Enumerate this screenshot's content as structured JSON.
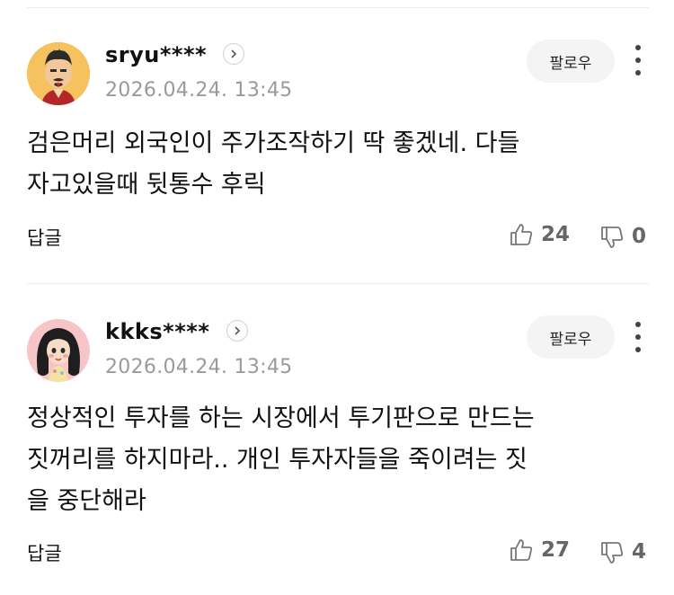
{
  "comments": [
    {
      "username": "sryu****",
      "timestamp": "2026.04.24. 13:45",
      "follow_label": "팔로우",
      "text": "검은머리 외국인이 주가조작하기 딱 좋겠네. 다들\n자고있을때 뒷통수 후릭",
      "reply_label": "답글",
      "likes": "24",
      "dislikes": "0"
    },
    {
      "username": "kkks****",
      "timestamp": "2026.04.24. 13:45",
      "follow_label": "팔로우",
      "text": "정상적인 투자를 하는 시장에서 투기판으로 만드는\n짓꺼리를 하지마라.. 개인 투자자들을 죽이려는 짓\n을 중단해라",
      "reply_label": "답글",
      "likes": "27",
      "dislikes": "4"
    }
  ]
}
